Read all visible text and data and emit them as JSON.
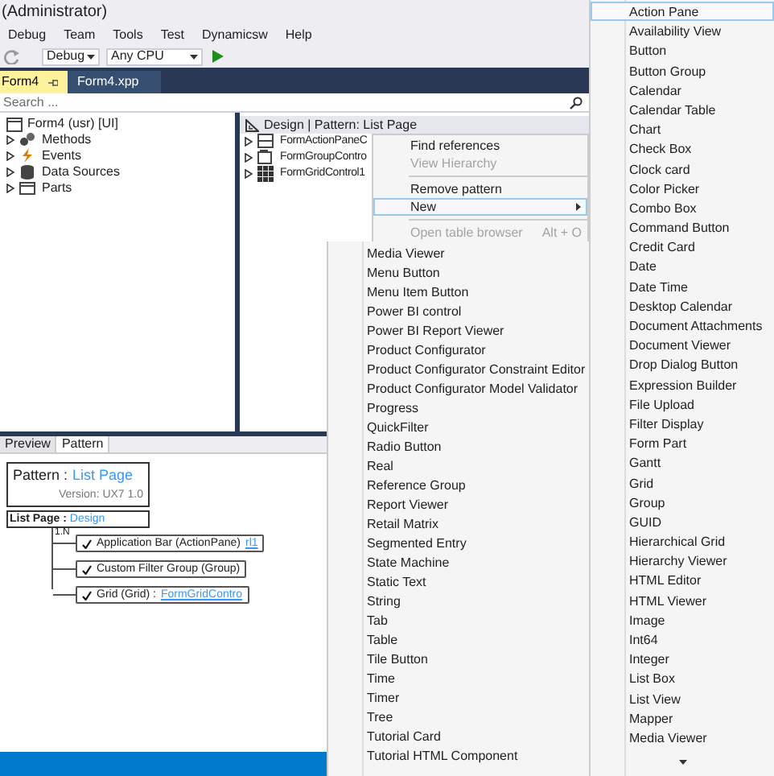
{
  "window": {
    "title": "(Administrator)"
  },
  "menu_bar": [
    "Debug",
    "Team",
    "Tools",
    "Test",
    "Dynamicsw",
    "Help"
  ],
  "toolbar": {
    "configuration": "Debug",
    "platform": "Any CPU"
  },
  "tabs": [
    {
      "label": "Form4",
      "selected": true
    },
    {
      "label": "Form4.xpp",
      "selected": false
    }
  ],
  "search": {
    "placeholder": "Search ..."
  },
  "element_tree": {
    "label": "Form4 (usr) [UI]",
    "children": [
      {
        "label": "Methods",
        "kind": "methods",
        "expanded": false
      },
      {
        "label": "Events",
        "kind": "events",
        "expanded": false
      },
      {
        "label": "Data Sources",
        "kind": "datasources",
        "expanded": false
      },
      {
        "label": "Parts",
        "kind": "parts",
        "expanded": false
      }
    ]
  },
  "design_tree": {
    "header": "Design | Pattern: List Page",
    "children": [
      {
        "label": "FormActionPaneC",
        "kind": "actionpane",
        "expanded": false
      },
      {
        "label": "FormGroupContro",
        "kind": "group",
        "expanded": false
      },
      {
        "label": "FormGridControl1",
        "kind": "grid",
        "expanded": false
      }
    ]
  },
  "context_menu": [
    {
      "kind": "item",
      "label": "Find references",
      "disabled": false,
      "selected": false
    },
    {
      "kind": "item",
      "label": "View Hierarchy",
      "disabled": true,
      "selected": false
    },
    {
      "kind": "separator"
    },
    {
      "kind": "item",
      "label": "Remove pattern",
      "disabled": false,
      "selected": false
    },
    {
      "kind": "submenu",
      "label": "New",
      "disabled": false,
      "selected": true
    },
    {
      "kind": "separator"
    },
    {
      "kind": "item",
      "label": "Open table browser",
      "shortcut": "Alt + O",
      "disabled": true,
      "selected": false
    }
  ],
  "new_submenu_left": [
    "Media Viewer",
    "Menu Button",
    "Menu Item Button",
    "Power BI control",
    "Power BI Report Viewer",
    "Product Configurator",
    "Product Configurator Constraint Editor",
    "Product Configurator Model Validator",
    "Progress",
    "QuickFilter",
    "Radio Button",
    "Real",
    "Reference Group",
    "Report Viewer",
    "Retail Matrix",
    "Segmented Entry",
    "State Machine",
    "Static Text",
    "String",
    "Tab",
    "Table",
    "Tile Button",
    "Time",
    "Timer",
    "Tree",
    "Tutorial Card",
    "Tutorial HTML Component"
  ],
  "new_submenu_right": [
    {
      "label": "Action Pane",
      "selected": true
    },
    {
      "label": "Availability View",
      "selected": false
    },
    {
      "label": "Button",
      "selected": false
    },
    {
      "label": "Button Group",
      "selected": false
    },
    {
      "label": "Calendar",
      "selected": false
    },
    {
      "label": "Calendar Table",
      "selected": false
    },
    {
      "label": "Chart",
      "selected": false
    },
    {
      "label": "Check Box",
      "selected": false
    },
    {
      "label": "Clock card",
      "selected": false
    },
    {
      "label": "Color Picker",
      "selected": false
    },
    {
      "label": "Combo Box",
      "selected": false
    },
    {
      "label": "Command Button",
      "selected": false
    },
    {
      "label": "Credit Card",
      "selected": false
    },
    {
      "label": "Date",
      "selected": false
    },
    {
      "label": "Date Time",
      "selected": false
    },
    {
      "label": "Desktop Calendar",
      "selected": false
    },
    {
      "label": "Document Attachments",
      "selected": false
    },
    {
      "label": "Document Viewer",
      "selected": false
    },
    {
      "label": "Drop Dialog Button",
      "selected": false
    },
    {
      "label": "Expression Builder",
      "selected": false
    },
    {
      "label": "File Upload",
      "selected": false
    },
    {
      "label": "Filter Display",
      "selected": false
    },
    {
      "label": "Form Part",
      "selected": false
    },
    {
      "label": "Gantt",
      "selected": false
    },
    {
      "label": "Grid",
      "selected": false
    },
    {
      "label": "Group",
      "selected": false
    },
    {
      "label": "GUID",
      "selected": false
    },
    {
      "label": "Hierarchical Grid",
      "selected": false
    },
    {
      "label": "Hierarchy Viewer",
      "selected": false
    },
    {
      "label": "HTML Editor",
      "selected": false
    },
    {
      "label": "HTML Viewer",
      "selected": false
    },
    {
      "label": "Image",
      "selected": false
    },
    {
      "label": "Int64",
      "selected": false
    },
    {
      "label": "Integer",
      "selected": false
    },
    {
      "label": "List Box",
      "selected": false
    },
    {
      "label": "List View",
      "selected": false
    },
    {
      "label": "Mapper",
      "selected": false
    },
    {
      "label": "Media Viewer",
      "selected": false
    }
  ],
  "bottom_tabs": [
    {
      "label": "Preview",
      "selected": false
    },
    {
      "label": "Pattern",
      "selected": true
    }
  ],
  "pattern_view": {
    "pattern_label": "Pattern :",
    "pattern_name": "List Page",
    "version": "Version: UX7 1.0",
    "root_label": "List Page :",
    "root_target": "Design",
    "multiplicity": "1.N",
    "items": [
      {
        "checked": true,
        "label": "Application Bar  (ActionPane)",
        "target": "rl1"
      },
      {
        "checked": true,
        "label": "Custom Filter Group  (Group)"
      },
      {
        "checked": true,
        "label": "Grid  (Grid) :",
        "target": "FormGridContro"
      }
    ]
  }
}
